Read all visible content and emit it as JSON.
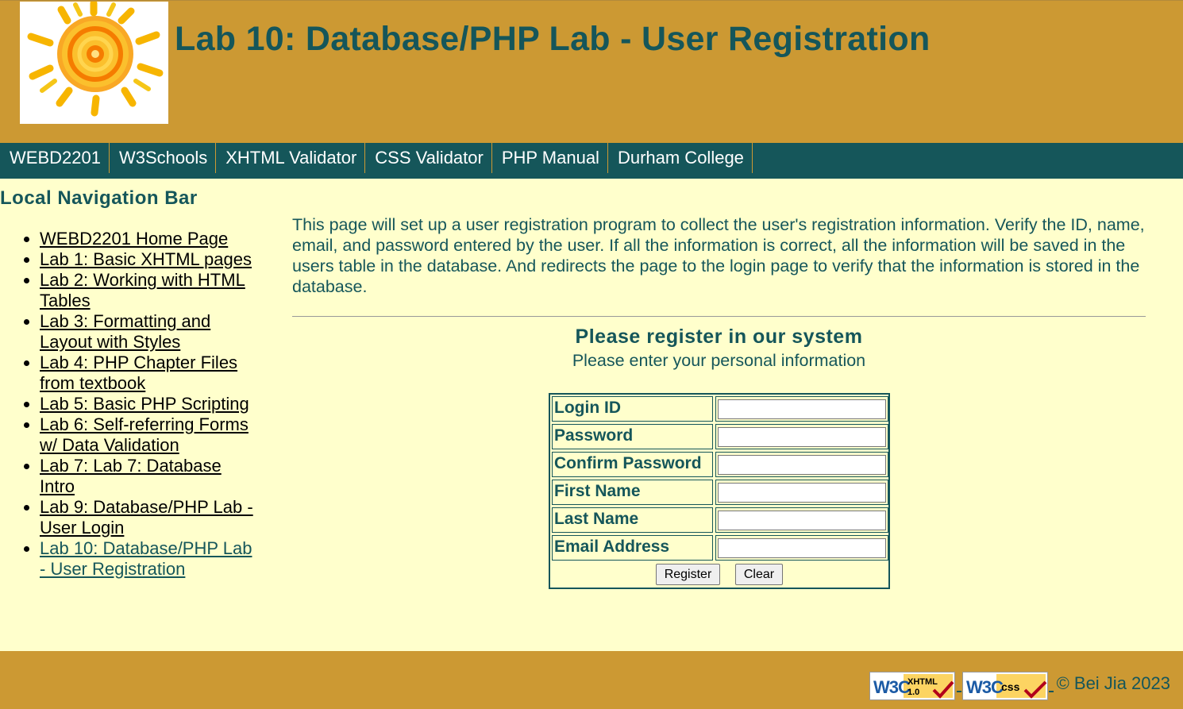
{
  "header": {
    "title": "Lab 10: Database/PHP Lab - User Registration",
    "logo_icon": "sun-logo-icon"
  },
  "topnav": {
    "items": [
      "WEBD2201",
      "W3Schools",
      "XHTML Validator",
      "CSS Validator",
      "PHP Manual",
      "Durham College"
    ]
  },
  "sidebar": {
    "title": "Local Navigation Bar",
    "items": [
      {
        "label": "WEBD2201 Home Page"
      },
      {
        "label": "Lab 1: Basic XHTML pages"
      },
      {
        "label": "Lab 2: Working with HTML Tables"
      },
      {
        "label": "Lab 3: Formatting and Layout with Styles"
      },
      {
        "label": "Lab 4: PHP Chapter Files from textbook"
      },
      {
        "label": "Lab 5: Basic PHP Scripting"
      },
      {
        "label": "Lab 6: Self-referring Forms w/ Data Validation"
      },
      {
        "label": "Lab 7: Lab 7: Database Intro"
      },
      {
        "label": "Lab 9: Database/PHP Lab - User Login"
      },
      {
        "label": "Lab 10: Database/PHP Lab - User Registration",
        "current": true
      }
    ]
  },
  "main": {
    "intro": "This page will set up a user registration program to collect the user's registration information. Verify the ID, name, email, and password entered by the user. If all the information is correct, all the information will be saved in the users table in the database. And redirects the page to the login page to verify that the information is stored in the database.",
    "form_heading": "Please register in our system",
    "form_subheading": "Please enter your personal information",
    "fields": [
      {
        "label": "Login ID",
        "value": ""
      },
      {
        "label": "Password",
        "value": ""
      },
      {
        "label": "Confirm Password",
        "value": ""
      },
      {
        "label": "First Name",
        "value": ""
      },
      {
        "label": "Last Name",
        "value": ""
      },
      {
        "label": "Email Address",
        "value": ""
      }
    ],
    "register_label": "Register",
    "clear_label": "Clear"
  },
  "footer": {
    "badges": [
      {
        "icon": "w3c-xhtml-valid-icon",
        "line1": "XHTML",
        "line2": "1.0"
      },
      {
        "icon": "w3c-css-valid-icon",
        "line1": "css"
      }
    ],
    "copyright": "© Bei Jia 2023"
  },
  "colors": {
    "gold": "#cc9933",
    "teal": "#15565a",
    "cream": "#ffffcc"
  }
}
